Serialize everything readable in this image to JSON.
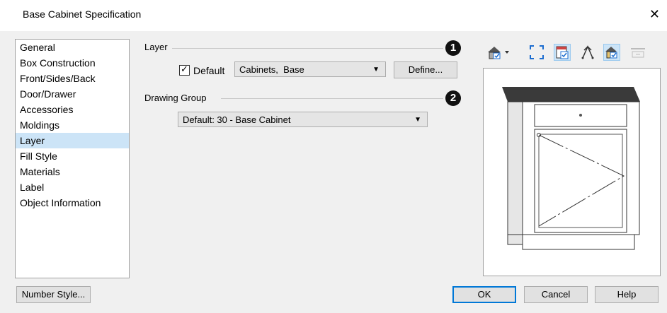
{
  "window": {
    "title": "Base Cabinet Specification",
    "close_glyph": "✕"
  },
  "sidebar": {
    "items": [
      {
        "label": "General"
      },
      {
        "label": "Box Construction"
      },
      {
        "label": "Front/Sides/Back"
      },
      {
        "label": "Door/Drawer"
      },
      {
        "label": "Accessories"
      },
      {
        "label": "Moldings"
      },
      {
        "label": "Layer",
        "selected": true
      },
      {
        "label": "Fill Style"
      },
      {
        "label": "Materials"
      },
      {
        "label": "Label"
      },
      {
        "label": "Object Information"
      }
    ]
  },
  "layer": {
    "group_label": "Layer",
    "callout": "1",
    "default_checked": true,
    "default_label": "Default",
    "check_glyph": "✓",
    "layer_value": "Cabinets,  Base",
    "define_label": "Define..."
  },
  "drawing_group": {
    "group_label": "Drawing Group",
    "callout": "2",
    "value": "Default: 30 - Base Cabinet"
  },
  "toolbar": {
    "icons": [
      "elevation-view-icon",
      "fill-window-icon",
      "show-cabinet-icon",
      "show-handles-icon",
      "show-materials-icon",
      "refresh-icon"
    ]
  },
  "footer": {
    "number_style_label": "Number Style...",
    "ok_label": "OK",
    "cancel_label": "Cancel",
    "help_label": "Help"
  },
  "colors": {
    "accent": "#0078d7",
    "selection": "#cce4f7",
    "countertop": "#3a3a3a",
    "callout": "#111111"
  }
}
